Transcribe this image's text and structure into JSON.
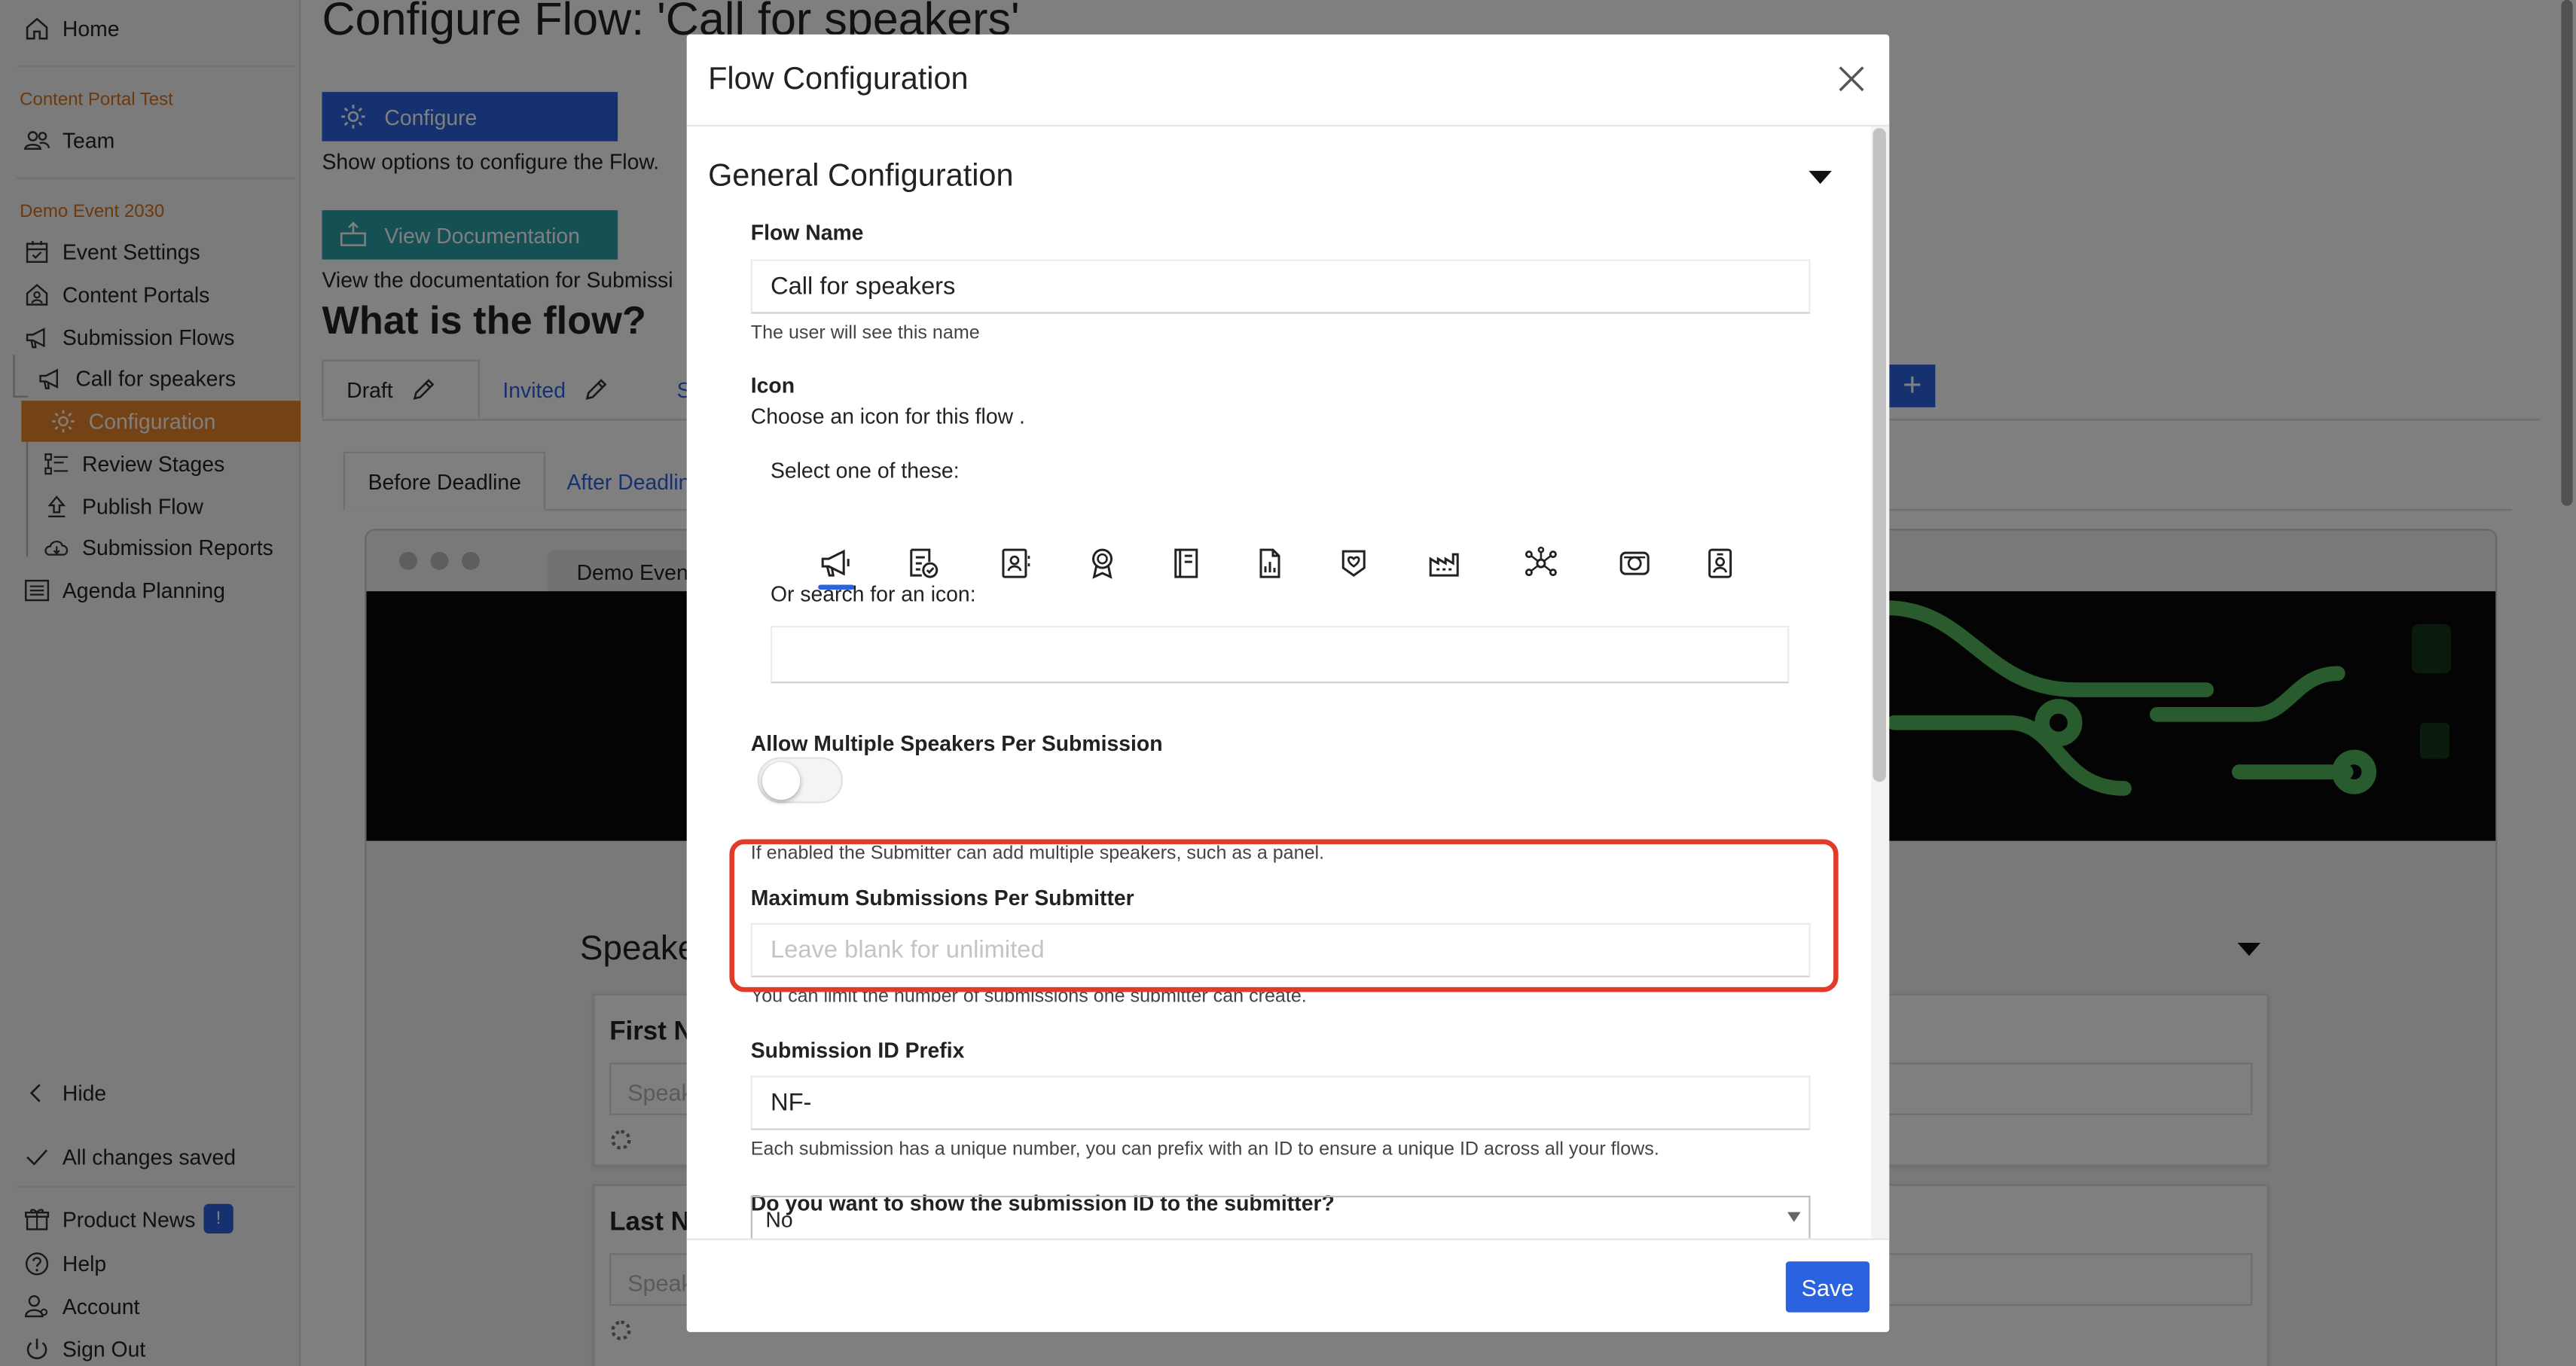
{
  "sidebar": {
    "home": "Home",
    "org_label": "Content Portal Test",
    "team": "Team",
    "event_label": "Demo Event 2030",
    "items": [
      "Event Settings",
      "Content Portals",
      "Submission Flows",
      "Call for speakers",
      "Configuration",
      "Review Stages",
      "Publish Flow",
      "Submission Reports",
      "Agenda Planning"
    ],
    "hide": "Hide",
    "saved_status": "All changes saved",
    "product_news": "Product News",
    "news_badge": "!",
    "help": "Help",
    "account": "Account",
    "sign_out": "Sign Out"
  },
  "main": {
    "title": "Configure Flow: 'Call for speakers'",
    "configure_btn": "Configure",
    "configure_help": "Show options to configure the Flow.",
    "docs_btn": "View Documentation",
    "docs_help": "View the documentation for Submissi",
    "flow_heading": "What is the flow?",
    "tabs": [
      "Draft",
      "Invited",
      "S"
    ],
    "plus": "+",
    "subtabs": [
      "Before Deadline",
      "After Deadlin"
    ],
    "preview_tab": "Demo Even",
    "speakers_heading": "Speake",
    "cards": [
      {
        "label": "First N",
        "placeholder": "Speak"
      },
      {
        "label": "Last N",
        "placeholder": "Speak"
      }
    ]
  },
  "modal": {
    "title": "Flow Configuration",
    "section_title": "General Configuration",
    "flow_name_label": "Flow Name",
    "flow_name_value": "Call for speakers",
    "flow_name_help": "The user will see this name",
    "icon_label": "Icon",
    "icon_desc": "Choose an icon for this flow .",
    "icon_select_label": "Select one of these:",
    "icon_options": [
      "megaphone-icon",
      "document-check-icon",
      "contact-card-icon",
      "award-icon",
      "book-icon",
      "file-chart-icon",
      "badge-heart-icon",
      "factory-icon",
      "network-icon",
      "webcam-icon",
      "id-badge-icon"
    ],
    "icon_search_label": "Or search for an icon:",
    "icon_search_value": "",
    "multi_speakers_label": "Allow Multiple Speakers Per Submission",
    "multi_speakers_enabled": false,
    "multi_speakers_help": "If enabled the Submitter can add multiple speakers, such as a panel.",
    "max_sub_label": "Maximum Submissions Per Submitter",
    "max_sub_placeholder": "Leave blank for unlimited",
    "max_sub_help": "You can limit the number of submissions one submitter can create.",
    "prefix_label": "Submission ID Prefix",
    "prefix_value": "NF-",
    "prefix_help": "Each submission has a unique number, you can prefix with an ID to ensure a unique ID across all your flows.",
    "show_id_label": "Do you want to show the submission ID to the submitter?",
    "show_id_value": "No",
    "save": "Save"
  },
  "colors": {
    "accent_blue": "#2b62e0",
    "teal": "#2aa3a8",
    "orange": "#e8842a",
    "highlight_red": "#e23b2a"
  }
}
